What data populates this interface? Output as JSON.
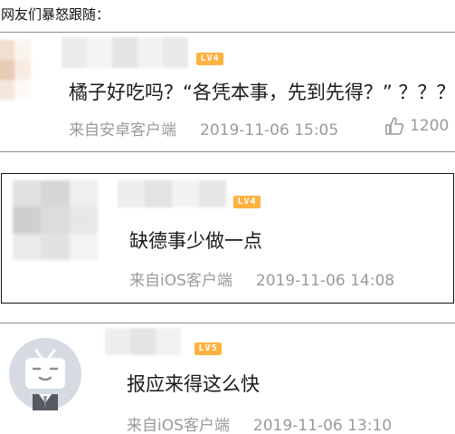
{
  "intro_text": "网友们暴怒跟随：",
  "comments": [
    {
      "level": "LV4",
      "text": "橘子好吃吗？“各凭本事，先到先得？” ？？？",
      "source": "来自安卓客户端",
      "time": "2019-11-06 15:05",
      "likes": "1200"
    },
    {
      "level": "LV4",
      "text": "缺德事少做一点",
      "source": "来自iOS客户端",
      "time": "2019-11-06 14:08"
    },
    {
      "level": "LV5",
      "text": "报应来得这么快",
      "source": "来自iOS客户端",
      "time": "2019-11-06 13:10"
    }
  ],
  "colors": {
    "badge": "#ffb23f",
    "meta_text": "#9a9a9a",
    "avatar_tv": "#d6dbe2"
  },
  "icons": {
    "like": "thumbs-up-icon",
    "avatar": "tv-mascot-icon"
  }
}
